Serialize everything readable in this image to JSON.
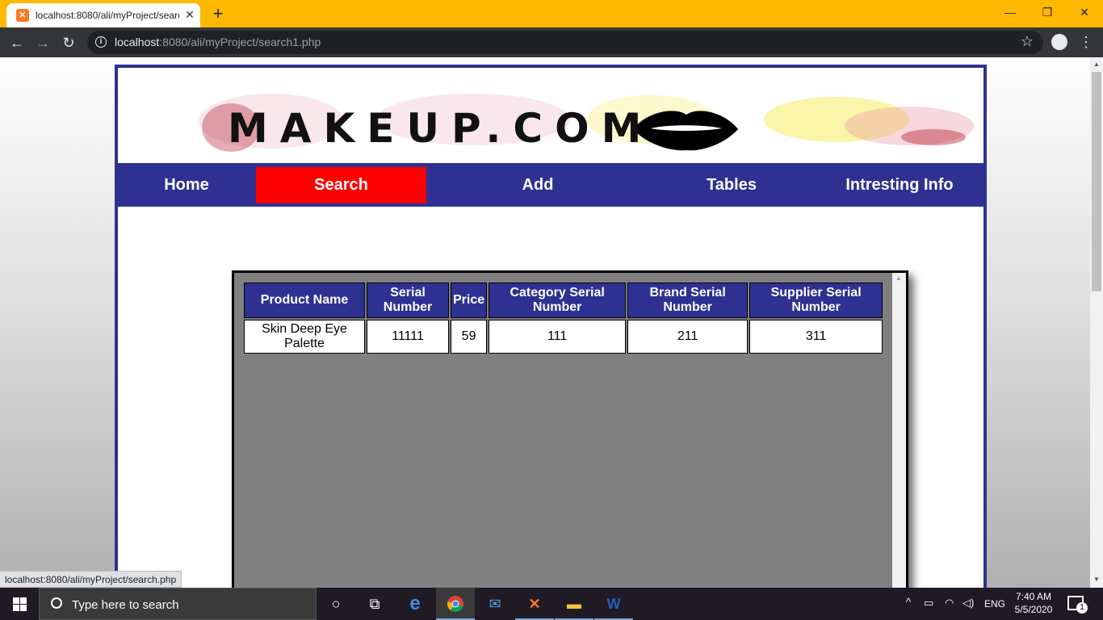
{
  "browser": {
    "tab_title": "localhost:8080/ali/myProject/search1.php",
    "url_host": "localhost",
    "url_path": ":8080/ali/myProject/search1.php",
    "status_url": "localhost:8080/ali/myProject/search.php"
  },
  "site": {
    "logo": "MAKEUP.COM",
    "nav": [
      {
        "label": "Home"
      },
      {
        "label": "Search",
        "active": true
      },
      {
        "label": "Add"
      },
      {
        "label": "Tables"
      },
      {
        "label": "Intresting Info"
      }
    ]
  },
  "table": {
    "headers": [
      "Product Name",
      "Serial Number",
      "Price",
      "Category Serial Number",
      "Brand Serial Number",
      "Supplier Serial Number"
    ],
    "rows": [
      [
        "Skin Deep Eye Palette",
        "11111",
        "59",
        "111",
        "211",
        "311"
      ]
    ]
  },
  "taskbar": {
    "search_placeholder": "Type here to search",
    "language": "ENG",
    "time": "7:40 AM",
    "date": "5/5/2020",
    "notification_count": "1"
  },
  "colors": {
    "title_bar": "#ffb900",
    "page_blue": "#2e3192",
    "active_nav": "#ff0000",
    "frame_gray": "#808080"
  }
}
